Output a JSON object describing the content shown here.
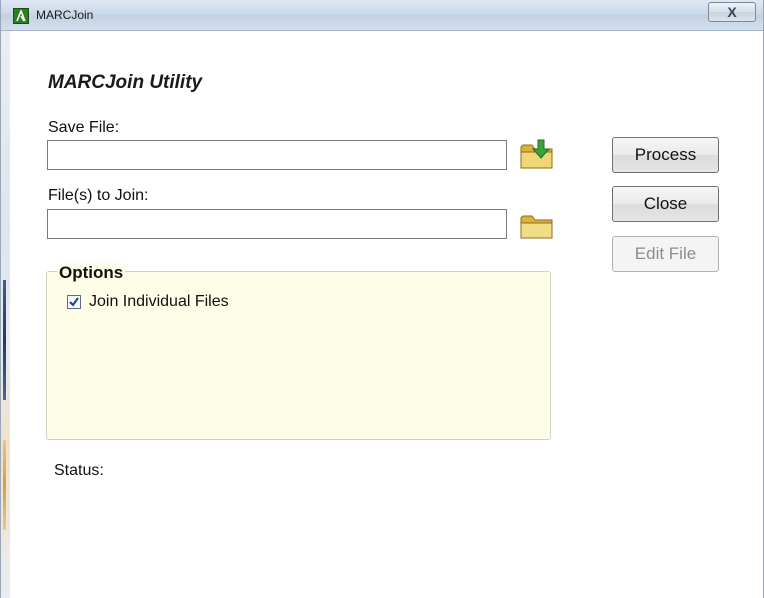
{
  "window": {
    "title": "MARCJoin",
    "close_symbol": "X"
  },
  "heading": "MARCJoin Utility",
  "save_file": {
    "label": "Save File:",
    "value": "",
    "browse_icon": "save-folder-icon"
  },
  "join_files": {
    "label": "File(s) to Join:",
    "value": "",
    "browse_icon": "open-folder-icon"
  },
  "buttons": {
    "process": "Process",
    "close": "Close",
    "edit_file": "Edit File"
  },
  "options": {
    "title": "Options",
    "join_individual": {
      "label": "Join Individual Files",
      "checked": true
    }
  },
  "status": {
    "label": "Status:"
  },
  "colors": {
    "options_background": "#fdfde8",
    "app_icon_green": "#2f7d22",
    "folder_yellow": "#e9c85a"
  }
}
